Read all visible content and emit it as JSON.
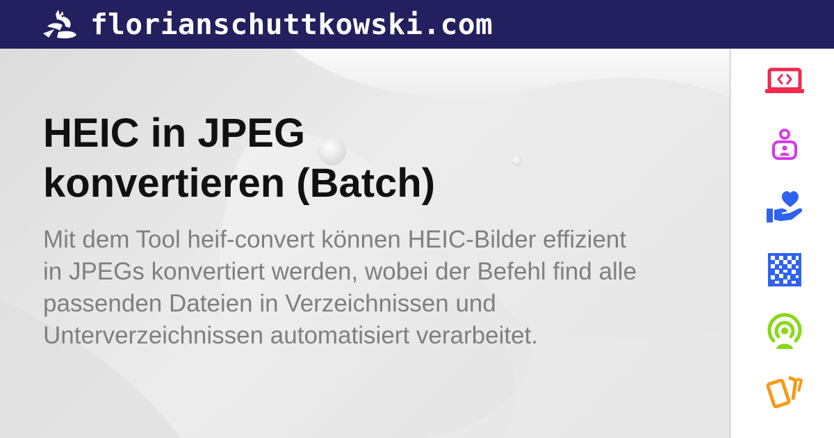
{
  "header": {
    "site_name": "florianschuttkowski.com",
    "logo_icon": "cat-logo-icon",
    "background": "#23205f"
  },
  "article": {
    "title": "HEIC in JPEG\nkonvertieren (Batch)",
    "description": "Mit dem Tool heif-convert können HEIC-Bilder effizient in JPEGs konvertiert werden, wobei der Befehl find alle passenden Dateien in Verzeichnissen und Unterverzeichnissen automatisiert verarbeitet."
  },
  "sidebar": {
    "icons": [
      {
        "name": "laptop-code-icon",
        "color": "#f0294d"
      },
      {
        "name": "user-badge-icon",
        "color": "#d63ae8"
      },
      {
        "name": "hand-heart-icon",
        "color": "#2f62f0"
      },
      {
        "name": "qr-code-icon",
        "color": "#2f62f0"
      },
      {
        "name": "podcast-user-icon",
        "color": "#88d816"
      },
      {
        "name": "cards-icon",
        "color": "#f39c1b"
      }
    ]
  }
}
